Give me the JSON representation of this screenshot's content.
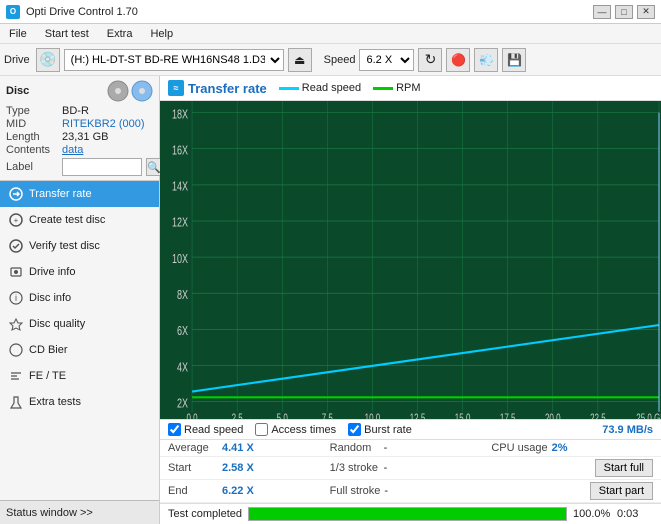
{
  "titleBar": {
    "title": "Opti Drive Control 1.70",
    "minBtn": "—",
    "maxBtn": "□",
    "closeBtn": "✕"
  },
  "menuBar": {
    "items": [
      "File",
      "Start test",
      "Extra",
      "Help"
    ]
  },
  "toolbar": {
    "driveLabel": "Drive",
    "driveValue": "(H:)  HL-DT-ST BD-RE  WH16NS48 1.D3",
    "speedLabel": "Speed",
    "speedValue": "6.2 X"
  },
  "disc": {
    "type": {
      "label": "Type",
      "value": "BD-R"
    },
    "mid": {
      "label": "MID",
      "value": "RITEKBR2 (000)"
    },
    "length": {
      "label": "Length",
      "value": "23,31 GB"
    },
    "contents": {
      "label": "Contents",
      "value": "data"
    },
    "label": {
      "label": "Label",
      "placeholder": ""
    }
  },
  "sidebar": {
    "items": [
      {
        "id": "transfer-rate",
        "label": "Transfer rate",
        "active": true
      },
      {
        "id": "create-test-disc",
        "label": "Create test disc",
        "active": false
      },
      {
        "id": "verify-test-disc",
        "label": "Verify test disc",
        "active": false
      },
      {
        "id": "drive-info",
        "label": "Drive info",
        "active": false
      },
      {
        "id": "disc-info",
        "label": "Disc info",
        "active": false
      },
      {
        "id": "disc-quality",
        "label": "Disc quality",
        "active": false
      },
      {
        "id": "cd-bier",
        "label": "CD Bier",
        "active": false
      },
      {
        "id": "fe-te",
        "label": "FE / TE",
        "active": false
      },
      {
        "id": "extra-tests",
        "label": "Extra tests",
        "active": false
      }
    ],
    "statusWindow": "Status window >>"
  },
  "chart": {
    "title": "Transfer rate",
    "legend": {
      "readSpeed": "Read speed",
      "rpm": "RPM"
    },
    "yLabels": [
      "18X",
      "16X",
      "14X",
      "12X",
      "10X",
      "8X",
      "6X",
      "4X",
      "2X"
    ],
    "xLabels": [
      "0.0",
      "2.5",
      "5.0",
      "7.5",
      "10.0",
      "12.5",
      "15.0",
      "17.5",
      "20.0",
      "22.5",
      "25.0 GB"
    ],
    "checkboxes": {
      "readSpeed": {
        "label": "Read speed",
        "checked": true
      },
      "accessTimes": {
        "label": "Access times",
        "checked": false
      },
      "burstRate": {
        "label": "Burst rate",
        "checked": true
      }
    },
    "burstRate": {
      "label": "Burst rate",
      "value": "73.9 MB/s"
    },
    "stats": {
      "average": {
        "label": "Average",
        "value": "4.41 X"
      },
      "random": {
        "label": "Random",
        "value": "-"
      },
      "cpuUsage": {
        "label": "CPU usage",
        "value": "2%"
      },
      "start": {
        "label": "Start",
        "value": "2.58 X"
      },
      "oneThirdStroke": {
        "label": "1/3 stroke",
        "value": "-"
      },
      "startFull": "Start full",
      "end": {
        "label": "End",
        "value": "6.22 X"
      },
      "fullStroke": {
        "label": "Full stroke",
        "value": "-"
      },
      "startPart": "Start part"
    }
  },
  "progressBar": {
    "statusText": "Test completed",
    "percent": "100.0%",
    "time": "0:03"
  }
}
